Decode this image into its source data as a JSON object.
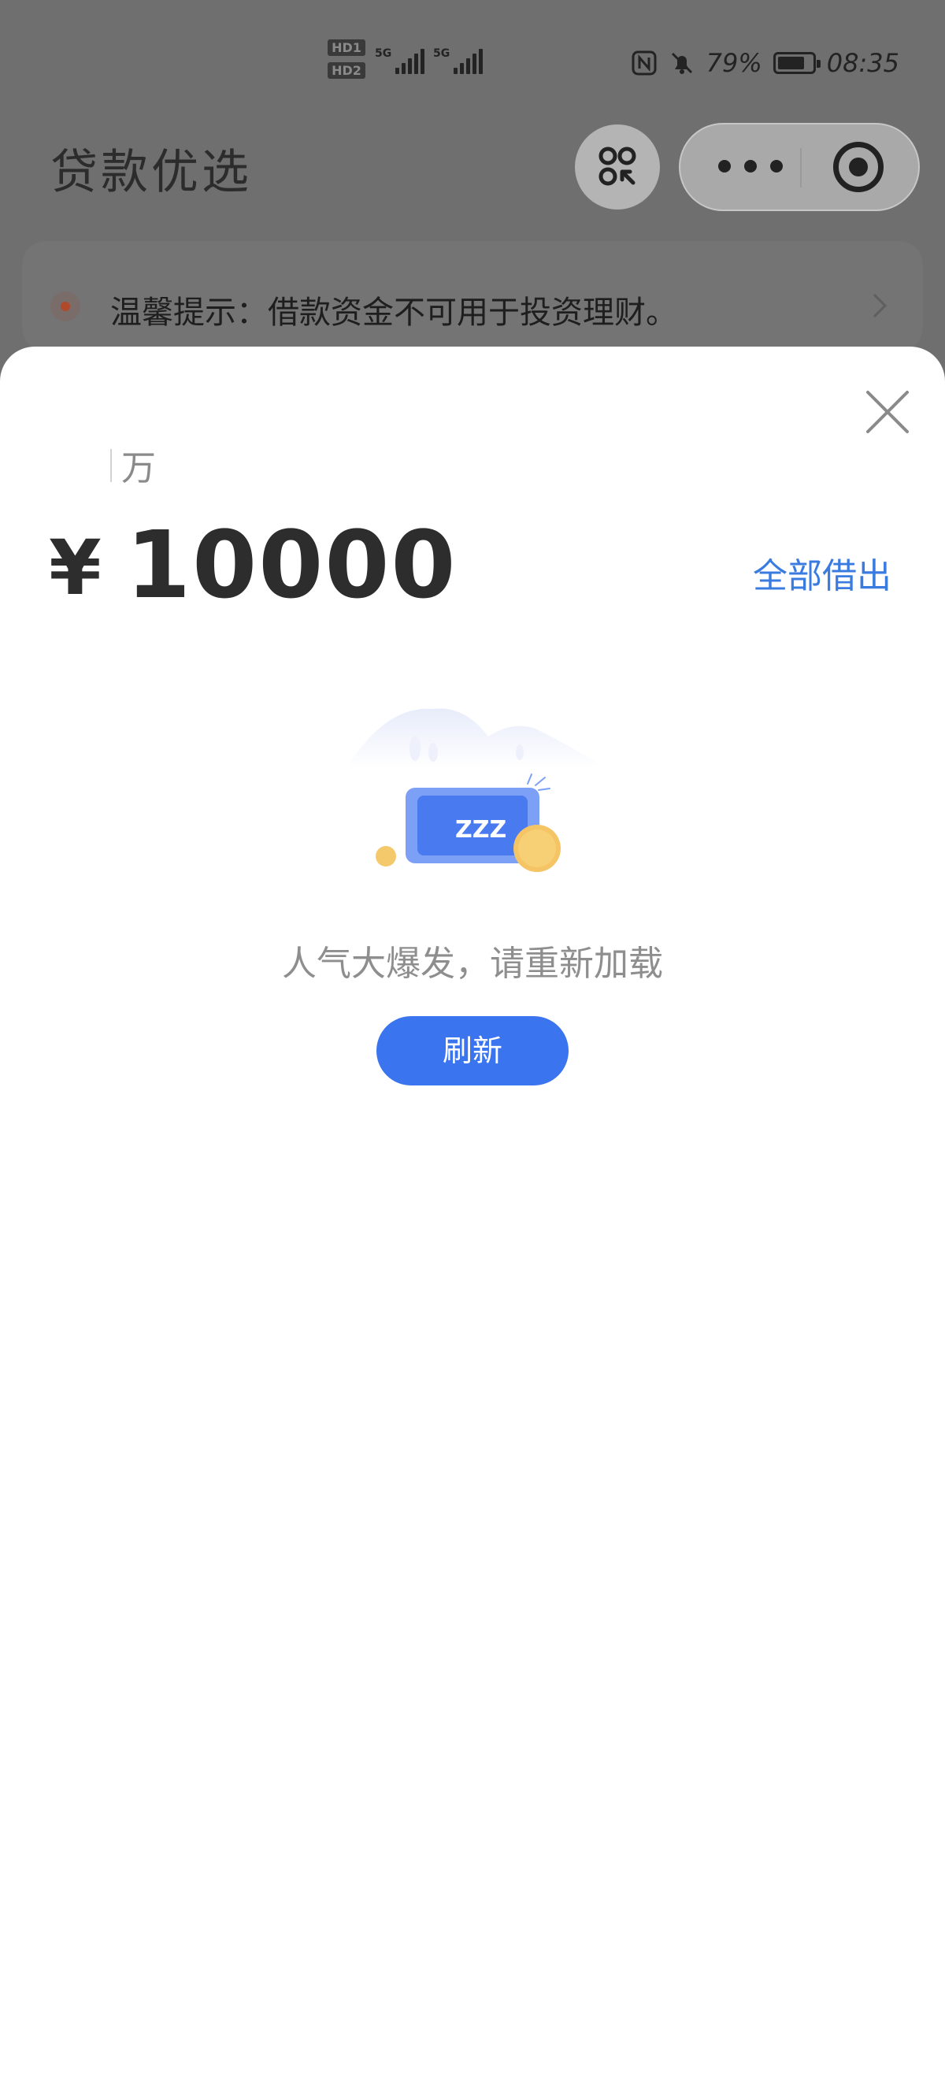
{
  "status_bar": {
    "hd1": "HD1",
    "hd2": "HD2",
    "signal1_label": "5G",
    "signal2_label": "5G",
    "battery_percent": "79%",
    "battery_level": 0.79,
    "time": "08:35",
    "icons": [
      "nfc-icon",
      "bell-muted-icon",
      "battery-icon"
    ]
  },
  "header": {
    "title": "贷款优选",
    "mini_program_icon": "exit-mini-program-icon",
    "capsule_more_icon": "more-dots-icon",
    "capsule_close_icon": "target-close-icon"
  },
  "notice": {
    "text": "温馨提示：借款资金不可用于投资理财。",
    "dot_color": "#b14a2a"
  },
  "sheet": {
    "unit": "万",
    "currency_symbol": "¥",
    "amount": "10000",
    "borrow_all_label": "全部借出",
    "empty_state": {
      "illustration_text": "ZZZ",
      "message": "人气大爆发，请重新加载",
      "refresh_label": "刷新"
    }
  },
  "colors": {
    "accent": "#3b74ef",
    "link": "#3a7be0",
    "overlay": "#6f6f70"
  }
}
